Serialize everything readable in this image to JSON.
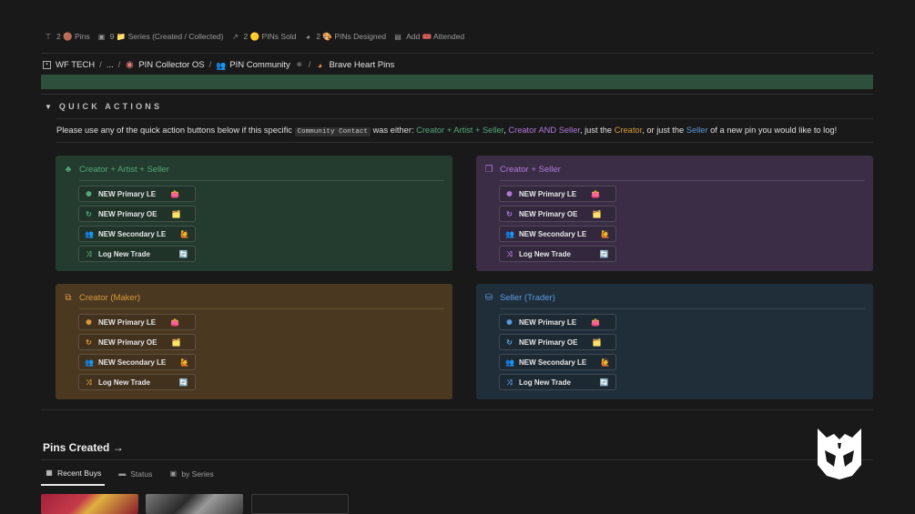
{
  "stats": [
    {
      "icon": "pin-icon",
      "text": "2 🟤 Pins"
    },
    {
      "icon": "folder-icon",
      "text": "9 📁 Series (Created / Collected)"
    },
    {
      "icon": "arrow-out-icon",
      "text": "2 🟡 PINs Sold"
    },
    {
      "icon": "palette-icon",
      "text": "2 🎨 PINs Designed"
    },
    {
      "icon": "calendar-icon",
      "text": "Add 🎟️ Attended"
    }
  ],
  "breadcrumbs": [
    {
      "icon": "page-icon",
      "label": "WF TECH"
    },
    {
      "label": "..."
    },
    {
      "icon": "pin-os-icon",
      "label": "PIN Collector OS"
    },
    {
      "icon": "people-icon",
      "label": "PIN Community"
    },
    {
      "icon": "brave-heart-icon",
      "label": "Brave Heart Pins"
    }
  ],
  "quick_actions": {
    "heading": "QUICK ACTIONS",
    "para": {
      "pre": "Please use any of the quick action buttons below if this specific ",
      "code": "Community Contact",
      "mid1": " was either: ",
      "creator_artist_seller": "Creator + Artist + Seller",
      "comma1": ", ",
      "creator_and_seller": "Creator AND Seller",
      "mid2": ", just the ",
      "creator": "Creator",
      "mid3": ", or just the ",
      "seller": "Seller",
      "post": " of a new pin you would like to log!"
    }
  },
  "cards": {
    "green": {
      "title": "Creator + Artist + Seller"
    },
    "purple": {
      "title": "Creator + Seller"
    },
    "orange": {
      "title": "Creator (Maker)"
    },
    "blue": {
      "title": "Seller (Trader)"
    }
  },
  "buttons": {
    "primary_le": {
      "label": "NEW Primary LE",
      "emoji": "👛"
    },
    "primary_oe": {
      "label": "NEW Primary OE",
      "emoji": "🗂️"
    },
    "secondary_le": {
      "label": "NEW Secondary LE",
      "emoji": "🙋"
    },
    "log_trade": {
      "label": "Log New Trade",
      "emoji": "🔄"
    }
  },
  "pins_created": {
    "title": "Pins Created →"
  },
  "tabs": [
    {
      "icon": "table-icon",
      "label": "Recent Buys",
      "active": true
    },
    {
      "icon": "folder-icon",
      "label": "Status"
    },
    {
      "icon": "gallery-icon",
      "label": "by Series"
    }
  ],
  "colors": {
    "green": "#52a878",
    "purple": "#b07ad9",
    "orange": "#d99a3a",
    "blue": "#5b9be0"
  }
}
